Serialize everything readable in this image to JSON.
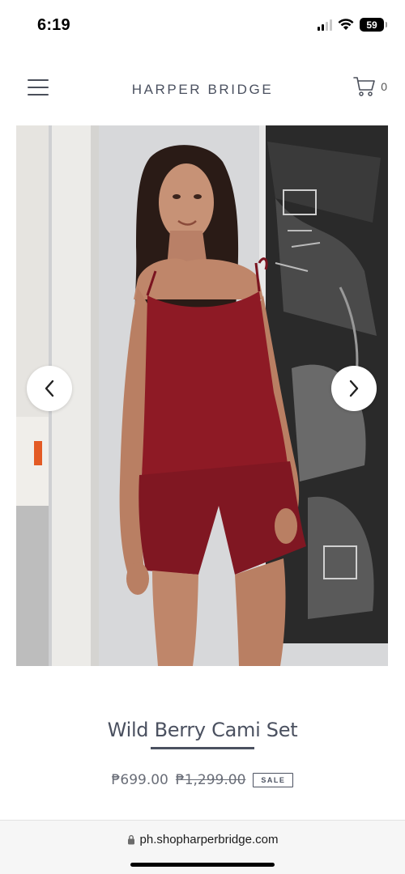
{
  "status_bar": {
    "time": "6:19",
    "battery": "59",
    "icons": [
      "signal-icon",
      "wifi-icon",
      "battery-icon"
    ]
  },
  "header": {
    "brand": "HARPER BRIDGE",
    "cart_count": "0",
    "icons": [
      "menu-icon",
      "cart-icon"
    ]
  },
  "gallery": {
    "icons": [
      "chevron-left-icon",
      "chevron-right-icon"
    ]
  },
  "product": {
    "title": "Wild Berry Cami Set",
    "price": "₱699.00",
    "compare_price": "₱1,299.00",
    "badge": "SALE"
  },
  "browser": {
    "url": "ph.shopharperbridge.com",
    "icons": [
      "lock-icon"
    ]
  },
  "colors": {
    "brand_text": "#4b5160",
    "garment": "#8e1a25",
    "background": "#ffffff"
  }
}
